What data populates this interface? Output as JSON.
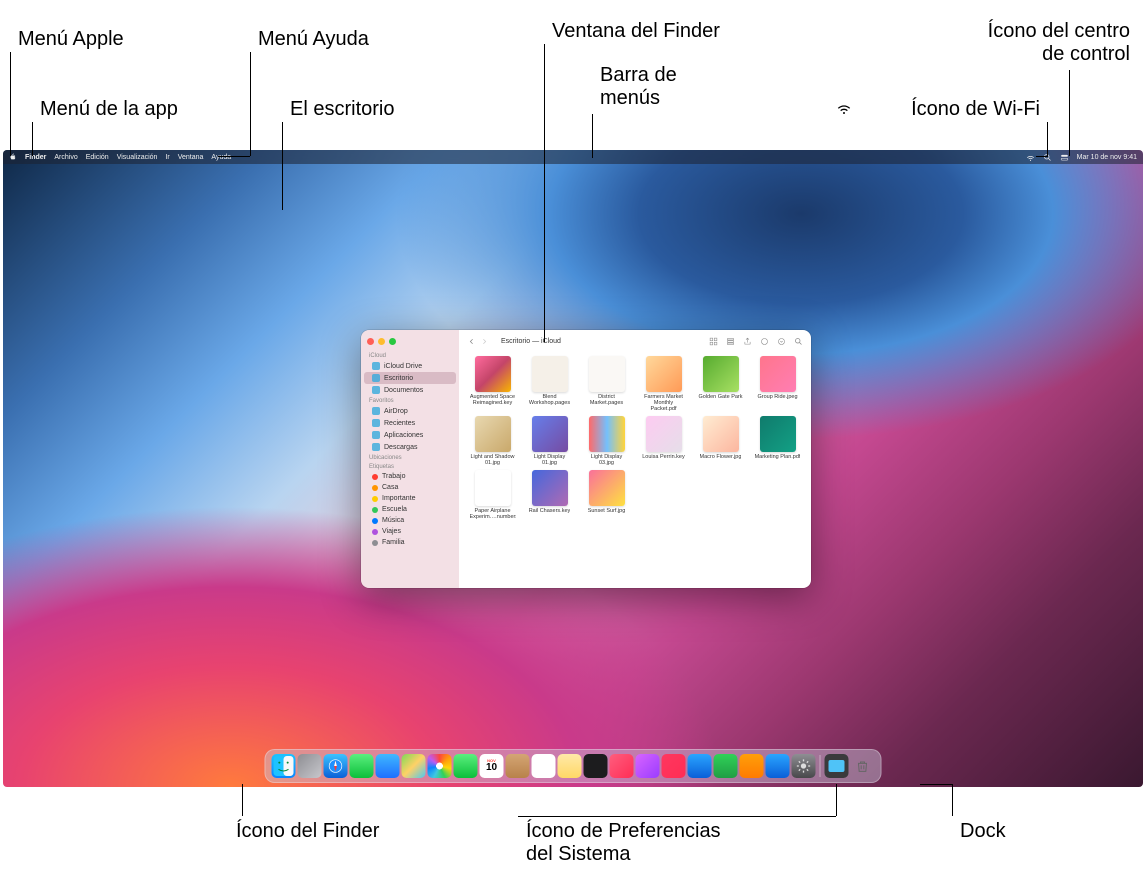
{
  "callouts": {
    "apple_menu": "Menú Apple",
    "app_menu": "Menú de la app",
    "help_menu": "Menú Ayuda",
    "desktop": "El escritorio",
    "finder_window": "Ventana del Finder",
    "menubar": "Barra de\nmenús",
    "wifi_icon": "Ícono de Wi-Fi",
    "control_center": "Ícono del centro\nde control",
    "finder_icon": "Ícono del Finder",
    "sysprefs_icon": "Ícono de Preferencias\ndel Sistema",
    "dock": "Dock"
  },
  "menubar": {
    "app": "Finder",
    "items": [
      "Archivo",
      "Edición",
      "Visualización",
      "Ir",
      "Ventana",
      "Ayuda"
    ],
    "datetime": "Mar 10 de nov  9:41"
  },
  "finder": {
    "title": "Escritorio — iCloud",
    "sidebar": {
      "sections": [
        {
          "title": "iCloud",
          "items": [
            {
              "label": "iCloud Drive",
              "icon": "cloud",
              "color": "#34aadc"
            },
            {
              "label": "Escritorio",
              "icon": "desktop",
              "color": "#34aadc",
              "selected": true
            },
            {
              "label": "Documentos",
              "icon": "doc",
              "color": "#34aadc"
            }
          ]
        },
        {
          "title": "Favoritos",
          "items": [
            {
              "label": "AirDrop",
              "icon": "airdrop",
              "color": "#34aadc"
            },
            {
              "label": "Recientes",
              "icon": "clock",
              "color": "#34aadc"
            },
            {
              "label": "Aplicaciones",
              "icon": "apps",
              "color": "#34aadc"
            },
            {
              "label": "Descargas",
              "icon": "download",
              "color": "#34aadc"
            }
          ]
        },
        {
          "title": "Ubicaciones",
          "items": []
        },
        {
          "title": "Etiquetas",
          "items": [
            {
              "label": "Trabajo",
              "tag": "#ff3b30"
            },
            {
              "label": "Casa",
              "tag": "#ff9500"
            },
            {
              "label": "Importante",
              "tag": "#ffcc00"
            },
            {
              "label": "Escuela",
              "tag": "#34c759"
            },
            {
              "label": "Música",
              "tag": "#007aff"
            },
            {
              "label": "Viajes",
              "tag": "#af52de"
            },
            {
              "label": "Familia",
              "tag": "#8e8e93"
            }
          ]
        }
      ]
    },
    "files": [
      {
        "name": "Augmented Space Reimagined.key",
        "bg": "linear-gradient(135deg,#ff6b9d,#c44569,#f8b500)"
      },
      {
        "name": "Blend Workshop.pages",
        "bg": "#f5f0e8"
      },
      {
        "name": "District Market.pages",
        "bg": "#faf8f5"
      },
      {
        "name": "Farmers Market Monthly Packet.pdf",
        "bg": "linear-gradient(135deg,#ffd89b,#ff9a56)"
      },
      {
        "name": "Golden Gate Park",
        "bg": "linear-gradient(135deg,#56ab2f,#a8e063)"
      },
      {
        "name": "Group Ride.jpeg",
        "bg": "linear-gradient(135deg,#ff758c,#ff7eb3)"
      },
      {
        "name": "Light and Shadow 01.jpg",
        "bg": "linear-gradient(135deg,#e8d8b0,#c9a86a)"
      },
      {
        "name": "Light Display 01.jpg",
        "bg": "linear-gradient(135deg,#667eea,#764ba2)"
      },
      {
        "name": "Light Display 03.jpg",
        "bg": "linear-gradient(90deg,#ff6a6a,#74c0fc,#ffd43b)"
      },
      {
        "name": "Louisa Perrin.key",
        "bg": "linear-gradient(135deg,#fdcbf1,#e6dee9)"
      },
      {
        "name": "Macro Flower.jpg",
        "bg": "linear-gradient(135deg,#ffecd2,#fcb69f)"
      },
      {
        "name": "Marketing Plan.pdf",
        "bg": "linear-gradient(135deg,#0f7b6c,#13a085)"
      },
      {
        "name": "Paper Airplane Experim….numbers",
        "bg": "#ffffff"
      },
      {
        "name": "Rail Chasers.key",
        "bg": "linear-gradient(135deg,#4568dc,#b06ab3)"
      },
      {
        "name": "Sunset Surf.jpg",
        "bg": "linear-gradient(135deg,#fa709a,#fee140)"
      }
    ]
  },
  "dock": {
    "apps": [
      {
        "name": "finder",
        "bg": "linear-gradient(180deg,#1ec3ff,#0a84ff)"
      },
      {
        "name": "launchpad",
        "bg": "linear-gradient(135deg,#8e8e93,#c7c7cc)"
      },
      {
        "name": "safari",
        "bg": "linear-gradient(180deg,#3cc3ff,#0a60d8)"
      },
      {
        "name": "messages",
        "bg": "linear-gradient(180deg,#5bef7e,#0bbf3a)"
      },
      {
        "name": "mail",
        "bg": "linear-gradient(180deg,#3fb8ff,#1e6fff)"
      },
      {
        "name": "maps",
        "bg": "linear-gradient(135deg,#7ed957,#ffd166,#4cc9f0)"
      },
      {
        "name": "photos",
        "bg": "radial-gradient(circle,#fff 20%,transparent 20%),conic-gradient(#ff453a,#ff9f0a,#ffd60a,#30d158,#40c8e0,#0a84ff,#bf5af2,#ff453a)"
      },
      {
        "name": "facetime",
        "bg": "linear-gradient(180deg,#5bef7e,#0bbf3a)"
      },
      {
        "name": "calendar",
        "bg": "#ffffff"
      },
      {
        "name": "contacts",
        "bg": "linear-gradient(180deg,#d4a574,#b8824a)"
      },
      {
        "name": "reminders",
        "bg": "#ffffff"
      },
      {
        "name": "notes",
        "bg": "linear-gradient(180deg,#ffe9a8,#ffd866)"
      },
      {
        "name": "tv",
        "bg": "#1c1c1e"
      },
      {
        "name": "music",
        "bg": "linear-gradient(135deg,#ff5e7e,#ff2d55)"
      },
      {
        "name": "podcasts",
        "bg": "linear-gradient(135deg,#d864ff,#9a3cff)"
      },
      {
        "name": "news",
        "bg": "linear-gradient(135deg,#ff375f,#ff2d55)"
      },
      {
        "name": "keynote",
        "bg": "linear-gradient(180deg,#2aa5ff,#0a5fd8)"
      },
      {
        "name": "numbers",
        "bg": "linear-gradient(180deg,#30d158,#1f9e44)"
      },
      {
        "name": "pages",
        "bg": "linear-gradient(180deg,#ff9f0a,#ff7b00)"
      },
      {
        "name": "appstore",
        "bg": "linear-gradient(180deg,#2aa5ff,#0a5fd8)"
      },
      {
        "name": "systemprefs",
        "bg": "linear-gradient(180deg,#8e8e93,#48484a)"
      }
    ],
    "extras": [
      {
        "name": "downloads",
        "bg": "linear-gradient(180deg,#6b7280,#374151)"
      },
      {
        "name": "trash",
        "bg": "linear-gradient(180deg,#e5e7eb,#9ca3af)"
      }
    ],
    "calendar_day": "10"
  }
}
